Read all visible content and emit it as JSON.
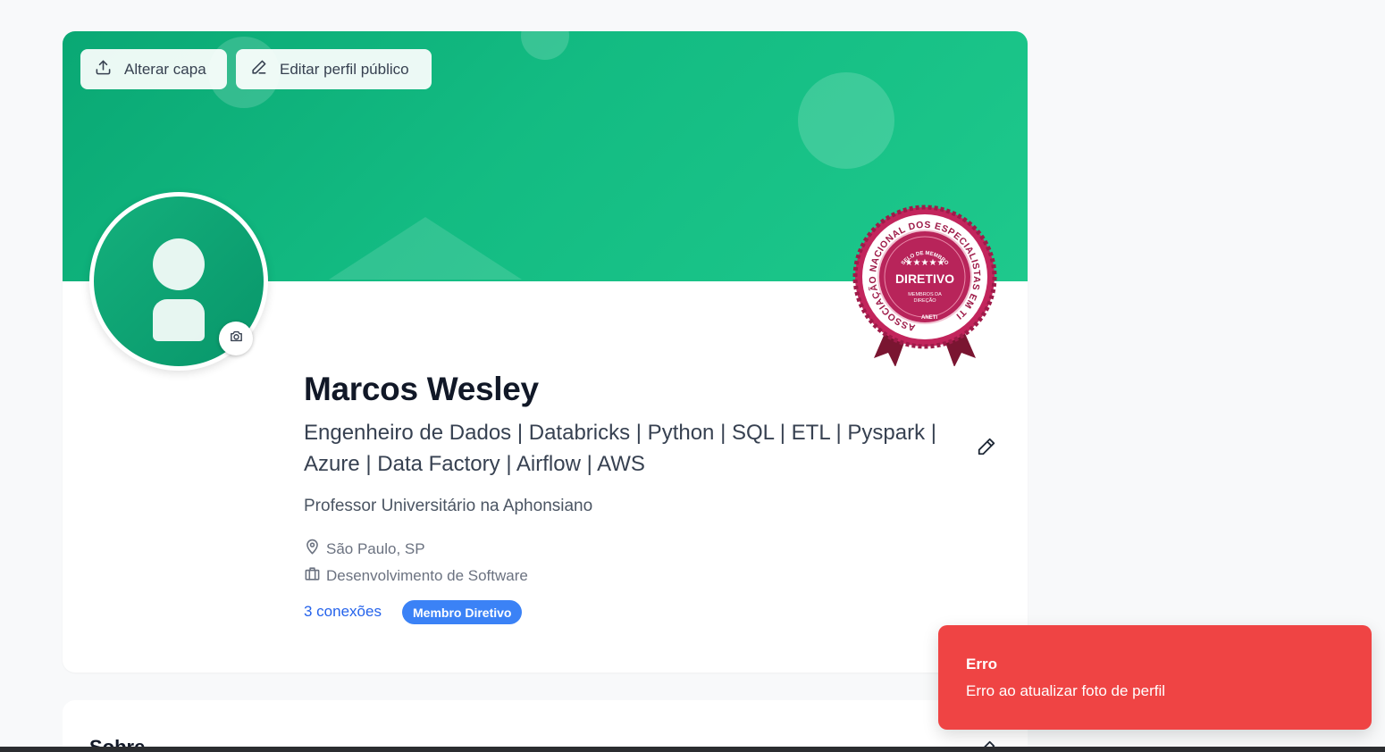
{
  "cover": {
    "change_cover_label": "Alterar capa",
    "edit_public_profile_label": "Editar perfil público",
    "upload_icon": "upload-icon",
    "pencil_icon": "pencil-icon"
  },
  "seal": {
    "ring_text": "ASSOCIAÇÃO NACIONAL DOS ESPECIALISTAS EM TI",
    "top_text": "SELO DE MEMBRO",
    "stars": "★★★★★",
    "title": "DIRETIVO",
    "line1": "MEMBROS DA",
    "line2": "DIREÇÃO",
    "org": "ANETI"
  },
  "profile": {
    "name": "Marcos Wesley",
    "headline": "Engenheiro de Dados | Databricks | Python | SQL | ETL | Pyspark | Azure | Data Factory | Airflow | AWS",
    "subtitle": "Professor Universitário na Aphonsiano",
    "location": "São Paulo, SP",
    "industry": "Desenvolvimento de Software",
    "connections": "3 conexões",
    "badge": "Membro Diretivo"
  },
  "about": {
    "title": "Sobre"
  },
  "toast": {
    "title": "Erro",
    "message": "Erro ao atualizar foto de perfil"
  },
  "colors": {
    "cover_green": "#13bb82",
    "accent_blue": "#3b82f6",
    "link_blue": "#2563eb",
    "toast_red": "#ef4444",
    "seal_crimson": "#b8245a"
  }
}
